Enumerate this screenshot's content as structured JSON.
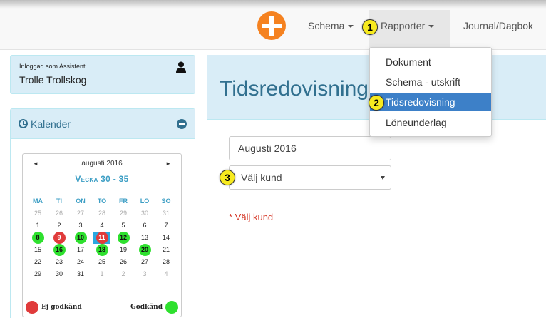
{
  "nav": {
    "items": [
      {
        "label": "Schema",
        "has_caret": true
      },
      {
        "label": "Rapporter",
        "has_caret": true
      },
      {
        "label": "Journal/Dagbok",
        "has_caret": false
      }
    ],
    "logo_color": "#f58220"
  },
  "dropdown": {
    "items": [
      {
        "label": "Dokument"
      },
      {
        "label": "Schema - utskrift"
      },
      {
        "label": "Tidsredovisning",
        "active": true
      },
      {
        "label": "Löneunderlag"
      }
    ]
  },
  "badges": {
    "b1": "1",
    "b2": "2",
    "b3": "3"
  },
  "user": {
    "role_label": "Inloggad som Assistent",
    "name": "Trolle Trollskog"
  },
  "calendar_panel": {
    "title": "Kalender",
    "month": "augusti 2016",
    "prev": "◄",
    "next": "►",
    "week_range": "Vecka 30 - 35",
    "day_headers": [
      "MÅ",
      "TI",
      "ON",
      "TO",
      "FR",
      "LÖ",
      "SÖ"
    ],
    "weeks": [
      [
        "25",
        "26",
        "27",
        "28",
        "29",
        "30",
        "31"
      ],
      [
        "1",
        "2",
        "3",
        "4",
        "5",
        "6",
        "7"
      ],
      [
        "8",
        "9",
        "10",
        "11",
        "12",
        "13",
        "14"
      ],
      [
        "15",
        "16",
        "17",
        "18",
        "19",
        "20",
        "21"
      ],
      [
        "22",
        "23",
        "24",
        "25",
        "26",
        "27",
        "28"
      ],
      [
        "29",
        "30",
        "31",
        "1",
        "2",
        "3",
        "4"
      ]
    ],
    "legend_rejected": "Ej godkänd",
    "legend_approved": "Godkänd",
    "colors": {
      "approved": "#2ee02e",
      "rejected": "#e03b3b",
      "today": "#29a8e0"
    }
  },
  "main": {
    "title": "Tidsredovisning",
    "month_value": "Augusti 2016",
    "customer_select": "Välj kund",
    "validation": "* Välj kund"
  }
}
